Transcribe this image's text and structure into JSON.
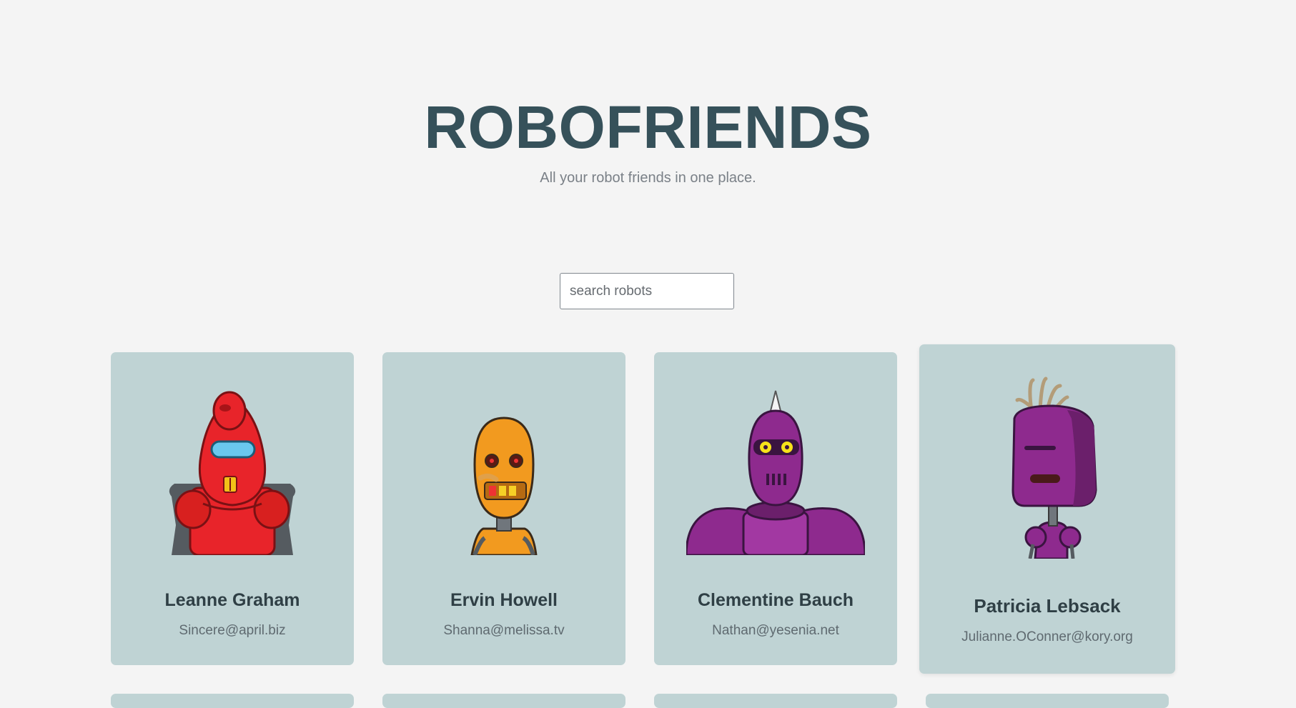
{
  "header": {
    "title": "ROBOFRIENDS",
    "subtitle": "All your robot friends in one place."
  },
  "search": {
    "placeholder": "search robots",
    "value": ""
  },
  "cards": [
    {
      "name": "Leanne Graham",
      "email": "Sincere@april.biz",
      "robot_color": "#e8242a"
    },
    {
      "name": "Ervin Howell",
      "email": "Shanna@melissa.tv",
      "robot_color": "#f29a1f"
    },
    {
      "name": "Clementine Bauch",
      "email": "Nathan@yesenia.net",
      "robot_color": "#8e2a8e"
    },
    {
      "name": "Patricia Lebsack",
      "email": "Julianne.OConner@kory.org",
      "robot_color": "#8e2a8e"
    }
  ],
  "colors": {
    "background": "#f4f4f4",
    "card": "#bfd3d4",
    "title": "#36515a"
  }
}
